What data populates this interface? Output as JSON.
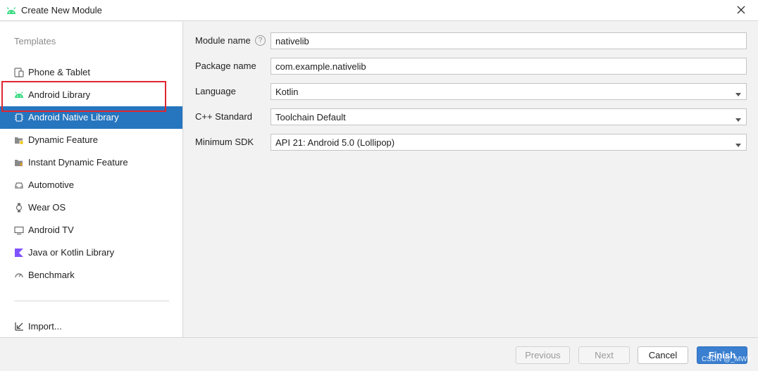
{
  "window": {
    "title": "Create New Module",
    "app_icon": "android-icon",
    "close_icon": "close-icon"
  },
  "sidebar": {
    "heading": "Templates",
    "items": [
      {
        "label": "Phone & Tablet",
        "icon": "phone-tablet-icon"
      },
      {
        "label": "Android Library",
        "icon": "android-icon"
      },
      {
        "label": "Android Native Library",
        "icon": "native-library-icon",
        "selected": true
      },
      {
        "label": "Dynamic Feature",
        "icon": "folder-icon"
      },
      {
        "label": "Instant Dynamic Feature",
        "icon": "folder-icon"
      },
      {
        "label": "Automotive",
        "icon": "car-icon"
      },
      {
        "label": "Wear OS",
        "icon": "watch-icon"
      },
      {
        "label": "Android TV",
        "icon": "tv-icon"
      },
      {
        "label": "Java or Kotlin Library",
        "icon": "kotlin-icon"
      },
      {
        "label": "Benchmark",
        "icon": "gauge-icon"
      }
    ],
    "import_label": "Import..."
  },
  "form": {
    "module_name": {
      "label": "Module name",
      "value": "nativelib",
      "help": "?"
    },
    "package_name": {
      "label": "Package name",
      "value": "com.example.nativelib"
    },
    "language": {
      "label": "Language",
      "value": "Kotlin"
    },
    "cpp_standard": {
      "label": "C++ Standard",
      "value": "Toolchain Default"
    },
    "minimum_sdk": {
      "label": "Minimum SDK",
      "value": "API 21: Android 5.0 (Lollipop)"
    }
  },
  "footer": {
    "previous": "Previous",
    "next": "Next",
    "cancel": "Cancel",
    "finish": "Finish"
  },
  "watermark": "CSDN @_MWY",
  "colors": {
    "selected_bg": "#2675bf",
    "highlight_border": "#e0262f",
    "primary_button": "#3a7fd0",
    "android_green": "#3ddc84"
  }
}
